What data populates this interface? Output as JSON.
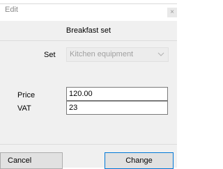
{
  "dialog": {
    "title": "Edit",
    "close_symbol": "×",
    "header": "Breakfast set"
  },
  "form": {
    "set_label": "Set",
    "set_value": "Kitchen equipment",
    "price_label": "Price",
    "price_value": "120.00",
    "vat_label": "VAT",
    "vat_value": "23"
  },
  "buttons": {
    "cancel": "Cancel",
    "change": "Change"
  },
  "colors": {
    "accent_border": "#0078d7",
    "dialog_bg": "#f0f0f0"
  },
  "icons": {
    "dropdown": "chevron-down-icon",
    "close": "close-icon"
  }
}
